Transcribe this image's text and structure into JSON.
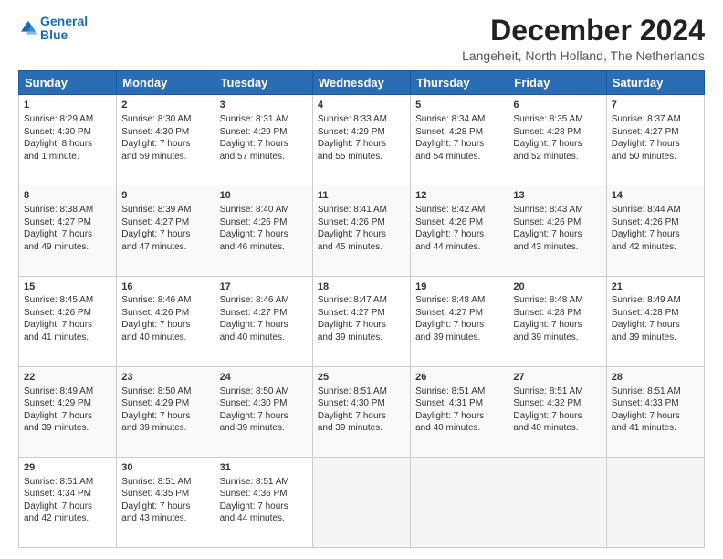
{
  "logo": {
    "line1": "General",
    "line2": "Blue"
  },
  "title": "December 2024",
  "location": "Langeheit, North Holland, The Netherlands",
  "days_of_week": [
    "Sunday",
    "Monday",
    "Tuesday",
    "Wednesday",
    "Thursday",
    "Friday",
    "Saturday"
  ],
  "weeks": [
    [
      {
        "day": "1",
        "info": "Sunrise: 8:29 AM\nSunset: 4:30 PM\nDaylight: 8 hours\nand 1 minute."
      },
      {
        "day": "2",
        "info": "Sunrise: 8:30 AM\nSunset: 4:30 PM\nDaylight: 7 hours\nand 59 minutes."
      },
      {
        "day": "3",
        "info": "Sunrise: 8:31 AM\nSunset: 4:29 PM\nDaylight: 7 hours\nand 57 minutes."
      },
      {
        "day": "4",
        "info": "Sunrise: 8:33 AM\nSunset: 4:29 PM\nDaylight: 7 hours\nand 55 minutes."
      },
      {
        "day": "5",
        "info": "Sunrise: 8:34 AM\nSunset: 4:28 PM\nDaylight: 7 hours\nand 54 minutes."
      },
      {
        "day": "6",
        "info": "Sunrise: 8:35 AM\nSunset: 4:28 PM\nDaylight: 7 hours\nand 52 minutes."
      },
      {
        "day": "7",
        "info": "Sunrise: 8:37 AM\nSunset: 4:27 PM\nDaylight: 7 hours\nand 50 minutes."
      }
    ],
    [
      {
        "day": "8",
        "info": "Sunrise: 8:38 AM\nSunset: 4:27 PM\nDaylight: 7 hours\nand 49 minutes."
      },
      {
        "day": "9",
        "info": "Sunrise: 8:39 AM\nSunset: 4:27 PM\nDaylight: 7 hours\nand 47 minutes."
      },
      {
        "day": "10",
        "info": "Sunrise: 8:40 AM\nSunset: 4:26 PM\nDaylight: 7 hours\nand 46 minutes."
      },
      {
        "day": "11",
        "info": "Sunrise: 8:41 AM\nSunset: 4:26 PM\nDaylight: 7 hours\nand 45 minutes."
      },
      {
        "day": "12",
        "info": "Sunrise: 8:42 AM\nSunset: 4:26 PM\nDaylight: 7 hours\nand 44 minutes."
      },
      {
        "day": "13",
        "info": "Sunrise: 8:43 AM\nSunset: 4:26 PM\nDaylight: 7 hours\nand 43 minutes."
      },
      {
        "day": "14",
        "info": "Sunrise: 8:44 AM\nSunset: 4:26 PM\nDaylight: 7 hours\nand 42 minutes."
      }
    ],
    [
      {
        "day": "15",
        "info": "Sunrise: 8:45 AM\nSunset: 4:26 PM\nDaylight: 7 hours\nand 41 minutes."
      },
      {
        "day": "16",
        "info": "Sunrise: 8:46 AM\nSunset: 4:26 PM\nDaylight: 7 hours\nand 40 minutes."
      },
      {
        "day": "17",
        "info": "Sunrise: 8:46 AM\nSunset: 4:27 PM\nDaylight: 7 hours\nand 40 minutes."
      },
      {
        "day": "18",
        "info": "Sunrise: 8:47 AM\nSunset: 4:27 PM\nDaylight: 7 hours\nand 39 minutes."
      },
      {
        "day": "19",
        "info": "Sunrise: 8:48 AM\nSunset: 4:27 PM\nDaylight: 7 hours\nand 39 minutes."
      },
      {
        "day": "20",
        "info": "Sunrise: 8:48 AM\nSunset: 4:28 PM\nDaylight: 7 hours\nand 39 minutes."
      },
      {
        "day": "21",
        "info": "Sunrise: 8:49 AM\nSunset: 4:28 PM\nDaylight: 7 hours\nand 39 minutes."
      }
    ],
    [
      {
        "day": "22",
        "info": "Sunrise: 8:49 AM\nSunset: 4:29 PM\nDaylight: 7 hours\nand 39 minutes."
      },
      {
        "day": "23",
        "info": "Sunrise: 8:50 AM\nSunset: 4:29 PM\nDaylight: 7 hours\nand 39 minutes."
      },
      {
        "day": "24",
        "info": "Sunrise: 8:50 AM\nSunset: 4:30 PM\nDaylight: 7 hours\nand 39 minutes."
      },
      {
        "day": "25",
        "info": "Sunrise: 8:51 AM\nSunset: 4:30 PM\nDaylight: 7 hours\nand 39 minutes."
      },
      {
        "day": "26",
        "info": "Sunrise: 8:51 AM\nSunset: 4:31 PM\nDaylight: 7 hours\nand 40 minutes."
      },
      {
        "day": "27",
        "info": "Sunrise: 8:51 AM\nSunset: 4:32 PM\nDaylight: 7 hours\nand 40 minutes."
      },
      {
        "day": "28",
        "info": "Sunrise: 8:51 AM\nSunset: 4:33 PM\nDaylight: 7 hours\nand 41 minutes."
      }
    ],
    [
      {
        "day": "29",
        "info": "Sunrise: 8:51 AM\nSunset: 4:34 PM\nDaylight: 7 hours\nand 42 minutes."
      },
      {
        "day": "30",
        "info": "Sunrise: 8:51 AM\nSunset: 4:35 PM\nDaylight: 7 hours\nand 43 minutes."
      },
      {
        "day": "31",
        "info": "Sunrise: 8:51 AM\nSunset: 4:36 PM\nDaylight: 7 hours\nand 44 minutes."
      },
      {
        "day": "",
        "info": ""
      },
      {
        "day": "",
        "info": ""
      },
      {
        "day": "",
        "info": ""
      },
      {
        "day": "",
        "info": ""
      }
    ]
  ]
}
